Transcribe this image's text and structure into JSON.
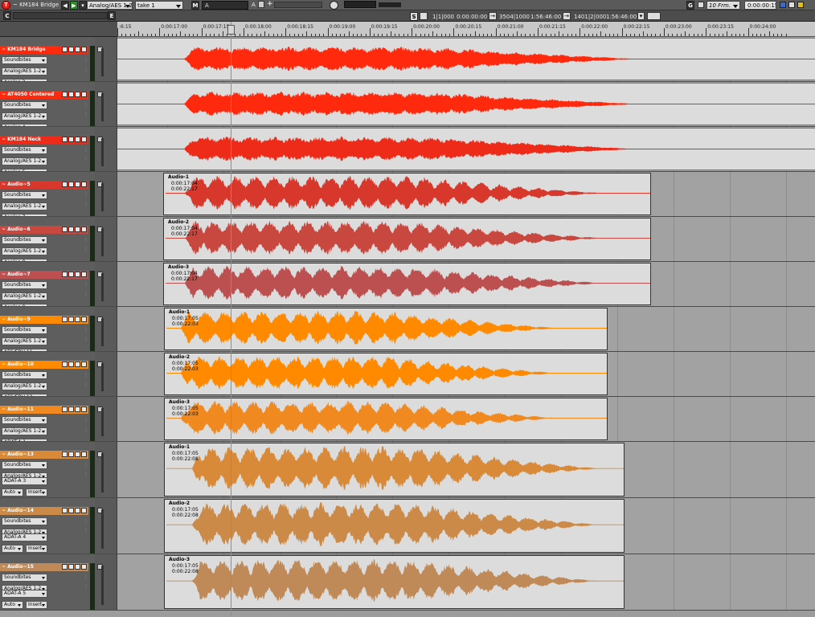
{
  "toolbar": {
    "track_name": "~ KM184 Bridge",
    "input_select": "Analog/AES 1-2",
    "take_select": "take 1",
    "m_label": "M",
    "a_label": "A",
    "a2_label": "A",
    "g_label": "G",
    "grid_select": "10 Frm.",
    "nudge_value": "0:00:00:15",
    "c_label": "C",
    "e_label": "E",
    "s_label": "S",
    "bbt": "1|1|000",
    "start_time": "0:00:00:00",
    "samples": "3504|1000",
    "end_time": "1:56:46:00",
    "bbt2": "1401|2|000",
    "length": "1:56:46:00"
  },
  "ruler": {
    "labels": [
      ":6:15",
      "0:00:17:00",
      "0:00:17:15",
      "0:00:18:00",
      "0:00:18:15",
      "0:00:19:00",
      "0:00:19:15",
      "0:00:20:00",
      "0:00:20:15",
      "0:00:21:00",
      "0:00:21:15",
      "0:00:22:00",
      "0:00:22:15",
      "0:00:23:00",
      "0:00:23:15",
      "0:00:24:00"
    ]
  },
  "colors": {
    "playhead": "#3ec43e",
    "red": "#ff2a0e",
    "orange": "#ff8a00"
  },
  "tracks": [
    {
      "name": "~ KM184 Bridge",
      "playlist": "Soundbites",
      "input": "Analog/AES 1-2",
      "output": "Analog 3",
      "color": "#ff2a0e",
      "region": {
        "name": "",
        "start": "",
        "end": ""
      }
    },
    {
      "name": "~ AT4050 Centered",
      "playlist": "Soundbites",
      "input": "Analog/AES 1-2",
      "output": "Analog 4",
      "color": "#ff2a0e",
      "region": {
        "name": "",
        "start": "",
        "end": ""
      }
    },
    {
      "name": "~ KM184 Neck",
      "playlist": "Soundbites",
      "input": "Analog/AES 1-2",
      "output": "Analog 5",
      "color": "#ee2a18",
      "region": {
        "name": "",
        "start": "",
        "end": ""
      }
    },
    {
      "name": "~ Audio~5",
      "playlist": "Soundbites",
      "input": "Analog/AES 1-2",
      "output": "Analog 7",
      "color": "#d8382c",
      "region": {
        "name": "Audio-1",
        "start": "0:00:17:04",
        "end": "0:00:22:17"
      }
    },
    {
      "name": "~ Audio~6",
      "playlist": "Soundbites",
      "input": "Analog/AES 1-2",
      "output": "Analog 8",
      "color": "#c84840",
      "region": {
        "name": "Audio-2",
        "start": "0:00:17:04",
        "end": "0:00:22:17"
      }
    },
    {
      "name": "~ Audio~7",
      "playlist": "Soundbites",
      "input": "Analog/AES 1-2",
      "output": "Analog 9",
      "color": "#bc5050",
      "region": {
        "name": "Audio-3",
        "start": "0:00:17:04",
        "end": "0:00:22:17"
      }
    },
    {
      "name": "~ Audio~9",
      "playlist": "Soundbites",
      "input": "Analog/AES 1-2",
      "output": "AES/EBU 11",
      "color": "#ff8a00",
      "region": {
        "name": "Audio-1",
        "start": "0:00:17:05",
        "end": "0:00:22:03"
      }
    },
    {
      "name": "~ Audio~10",
      "playlist": "Soundbites",
      "input": "Analog/AES 1-2",
      "output": "AES/EBU 12",
      "color": "#ff8a00",
      "region": {
        "name": "Audio-2",
        "start": "0:00:17:05",
        "end": "0:00:22:03"
      }
    },
    {
      "name": "~ Audio~11",
      "playlist": "Soundbites",
      "input": "Analog/AES 1-2",
      "output": "ADAT-A 1",
      "color": "#f08a20",
      "region": {
        "name": "Audio-3",
        "start": "0:00:17:05",
        "end": "0:00:22:03"
      }
    },
    {
      "name": "~ Audio~13",
      "playlist": "Soundbites",
      "input": "Analog/AES 1-2",
      "output": "ADAT-A 3",
      "auto": "Auto",
      "insert": "Insert",
      "color": "#d88a38",
      "region": {
        "name": "Audio-1",
        "start": "0:00:17:05",
        "end": "0:00:22:08"
      }
    },
    {
      "name": "~ Audio~14",
      "playlist": "Soundbites",
      "input": "Analog/AES 1-2",
      "output": "ADAT-A 4",
      "auto": "Auto",
      "insert": "Insert",
      "color": "#cc8a48",
      "region": {
        "name": "Audio-2",
        "start": "0:00:17:05",
        "end": "0:00:22:08"
      }
    },
    {
      "name": "~ Audio~15",
      "playlist": "Soundbites",
      "input": "Analog/AES 1-2",
      "output": "ADAT-A 5",
      "auto": "Auto",
      "insert": "Insert",
      "color": "#c08a58",
      "region": {
        "name": "Audio-3",
        "start": "0:00:17:05",
        "end": "0:00:22:08"
      }
    }
  ]
}
